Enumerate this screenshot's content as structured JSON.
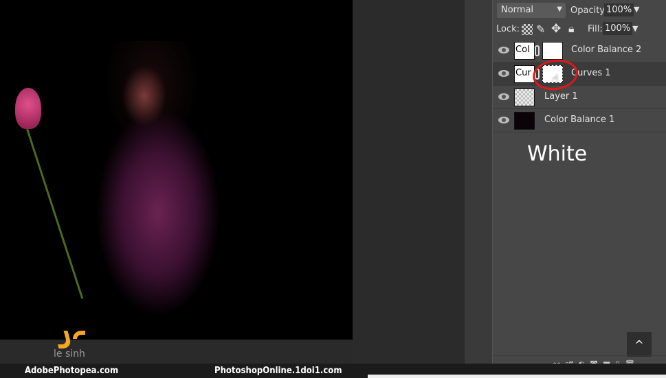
{
  "layers_panel": {
    "blend_mode": "Normal",
    "opacity_label": "Opacity:",
    "opacity": "100%",
    "lock_label": "Lock:",
    "fill_label": "Fill:",
    "fill": "100%",
    "layers": [
      {
        "name": "Color Balance 2",
        "thumb_text": "Col",
        "visible": true
      },
      {
        "name": "Curves 1",
        "thumb_text": "Cur",
        "visible": true,
        "active": true
      },
      {
        "name": "Layer 1",
        "visible": true
      },
      {
        "name": "Color Balance 1",
        "visible": true
      }
    ],
    "caption": "White",
    "scroll_up": "^",
    "bottom_fx": "eff"
  },
  "watermark": {
    "logo_text": "le sinh"
  },
  "footer": {
    "left": "AdobePhotopea.com",
    "right": "PhotoshopOnline.1doi1.com"
  },
  "colors": {
    "annotation": "#e01818",
    "logo": "#f5a623"
  }
}
